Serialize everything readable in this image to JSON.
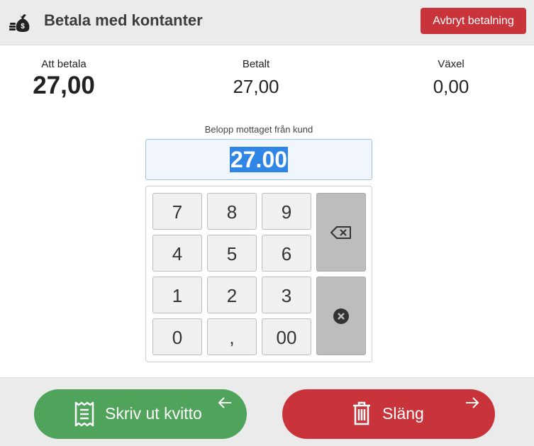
{
  "header": {
    "title": "Betala med kontanter",
    "icon": "money-bag-icon",
    "cancel_label": "Avbryt betalning"
  },
  "summary": {
    "att_betala_label": "Att betala",
    "att_betala_value": "27,00",
    "betalt_label": "Betalt",
    "betalt_value": "27,00",
    "vaxel_label": "Växel",
    "vaxel_value": "0,00"
  },
  "amount": {
    "label": "Belopp mottaget från kund",
    "value": "27.00"
  },
  "keypad": {
    "keys": [
      "7",
      "8",
      "9",
      "4",
      "5",
      "6",
      "1",
      "2",
      "3",
      "0",
      ",",
      "00"
    ],
    "backspace_icon": "backspace-icon",
    "clear_icon": "clear-icon"
  },
  "footer": {
    "print_label": "Skriv ut kvitto",
    "print_icon": "receipt-icon",
    "discard_label": "Släng",
    "discard_icon": "trash-icon"
  },
  "colors": {
    "accent_red": "#c9343a",
    "accent_green": "#4fa35a",
    "selection_blue": "#2f86e6"
  }
}
